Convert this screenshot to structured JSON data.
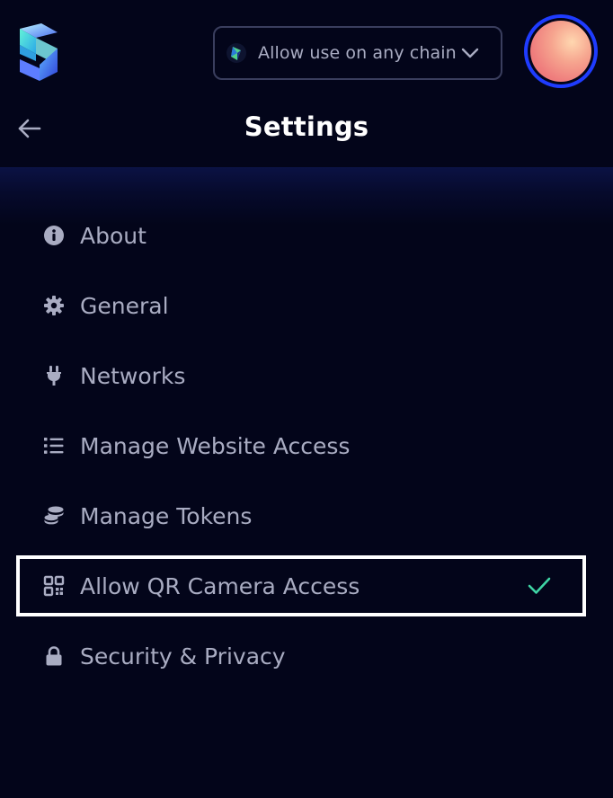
{
  "header": {
    "title": "Settings",
    "chain_selector": {
      "label": "Allow use on any chain"
    }
  },
  "menu": {
    "items": [
      {
        "label": "About",
        "icon": "info-icon"
      },
      {
        "label": "General",
        "icon": "gear-icon"
      },
      {
        "label": "Networks",
        "icon": "plug-icon"
      },
      {
        "label": "Manage Website Access",
        "icon": "list-icon"
      },
      {
        "label": "Manage Tokens",
        "icon": "coins-icon"
      },
      {
        "label": "Allow QR Camera Access",
        "icon": "qr-code-icon",
        "checked": true
      },
      {
        "label": "Security & Privacy",
        "icon": "lock-icon"
      }
    ]
  },
  "colors": {
    "background": "#03051a",
    "text": "#a9acc2",
    "title": "#ffffff",
    "accent_check": "#3fd5a5",
    "avatar_ring": "#1f3cff"
  }
}
